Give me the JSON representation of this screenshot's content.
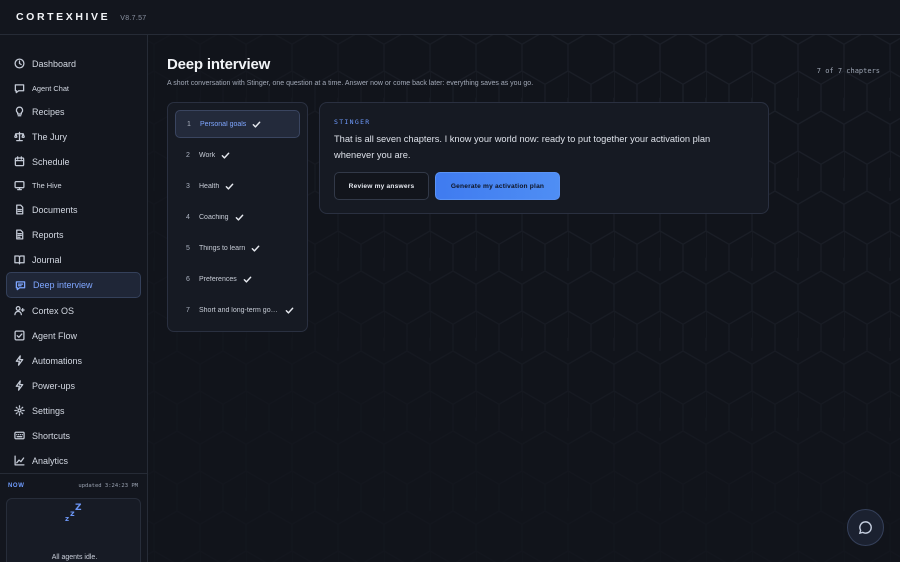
{
  "app": {
    "brand": "CORTEXHIVE",
    "version": "V8.7.57"
  },
  "sidebar": {
    "items": [
      {
        "label": "Dashboard",
        "icon": "clock-icon"
      },
      {
        "label": "Agent Chat",
        "icon": "chat-icon"
      },
      {
        "label": "Recipes",
        "icon": "bulb-icon"
      },
      {
        "label": "The Jury",
        "icon": "scales-icon"
      },
      {
        "label": "Schedule",
        "icon": "calendar-icon"
      },
      {
        "label": "The Hive",
        "icon": "monitor-icon"
      },
      {
        "label": "Documents",
        "icon": "document-icon"
      },
      {
        "label": "Reports",
        "icon": "report-icon"
      },
      {
        "label": "Journal",
        "icon": "book-icon"
      },
      {
        "label": "Deep interview",
        "icon": "message-icon",
        "active": true
      },
      {
        "label": "Cortex OS",
        "icon": "user-plus-icon"
      },
      {
        "label": "Agent Flow",
        "icon": "flow-icon"
      },
      {
        "label": "Automations",
        "icon": "bolt-icon"
      },
      {
        "label": "Power-ups",
        "icon": "zap-icon"
      },
      {
        "label": "Settings",
        "icon": "gear-icon"
      },
      {
        "label": "Shortcuts",
        "icon": "keyboard-icon"
      },
      {
        "label": "Analytics",
        "icon": "chart-icon"
      }
    ]
  },
  "now": {
    "label": "NOW",
    "updated": "updated 3:24:23 PM",
    "idle_text": "All agents idle."
  },
  "main": {
    "title": "Deep interview",
    "subtitle": "A short conversation with Stinger, one question at a time. Answer now or come back later: everything saves as you go.",
    "chapter_count": "7 of 7 chapters",
    "chapters": [
      {
        "num": "1",
        "label": "Personal goals",
        "done": true,
        "active": true
      },
      {
        "num": "2",
        "label": "Work",
        "done": true
      },
      {
        "num": "3",
        "label": "Health",
        "done": true
      },
      {
        "num": "4",
        "label": "Coaching",
        "done": true
      },
      {
        "num": "5",
        "label": "Things to learn",
        "done": true
      },
      {
        "num": "6",
        "label": "Preferences",
        "done": true
      },
      {
        "num": "7",
        "label": "Short and long-term goals",
        "done": true
      }
    ],
    "card": {
      "speaker": "STINGER",
      "message": "That is all seven chapters. I know your world now: ready to put together your activation plan whenever you are.",
      "secondary_button": "Review my answers",
      "primary_button": "Generate my activation plan"
    }
  },
  "colors": {
    "accent": "#4f8ef4",
    "background": "#12151d",
    "active_text": "#7fa6ff"
  }
}
